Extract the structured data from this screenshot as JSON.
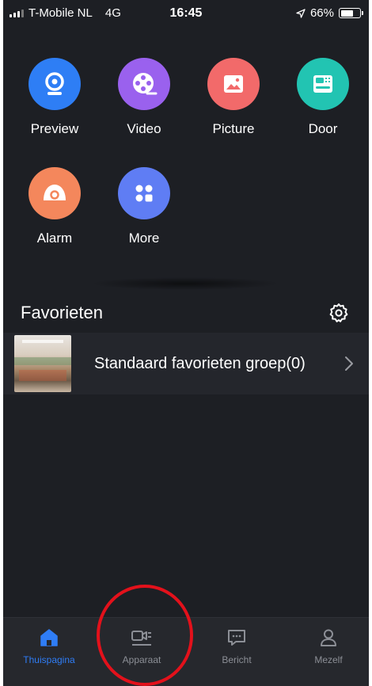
{
  "status_bar": {
    "carrier": "T-Mobile NL",
    "network": "4G",
    "time": "16:45",
    "battery": "66%",
    "battery_level": 0.66
  },
  "features": [
    {
      "label": "Preview",
      "color": "#2e7ef5",
      "icon": "webcam-icon"
    },
    {
      "label": "Video",
      "color": "#9a61ee",
      "icon": "film-reel-icon"
    },
    {
      "label": "Picture",
      "color": "#f26a6a",
      "icon": "image-icon"
    },
    {
      "label": "Door",
      "color": "#22c4b2",
      "icon": "door-intercom-icon"
    },
    {
      "label": "Alarm",
      "color": "#f4875c",
      "icon": "alarm-icon"
    },
    {
      "label": "More",
      "color": "#5f7df4",
      "icon": "grid-icon"
    }
  ],
  "favorites": {
    "title": "Favorieten",
    "settings_icon": "gear-icon",
    "group_label": "Standaard favorieten groep(0)"
  },
  "tabs": [
    {
      "label": "Thuispagina",
      "icon": "home-icon",
      "active": true
    },
    {
      "label": "Apparaat",
      "icon": "device-icon",
      "active": false
    },
    {
      "label": "Bericht",
      "icon": "message-icon",
      "active": false
    },
    {
      "label": "Mezelf",
      "icon": "profile-icon",
      "active": false
    }
  ],
  "colors": {
    "background": "#1d1f24",
    "tab_active": "#2f7df6",
    "tab_inactive": "#8c8f96",
    "annotation": "#e3111b"
  }
}
